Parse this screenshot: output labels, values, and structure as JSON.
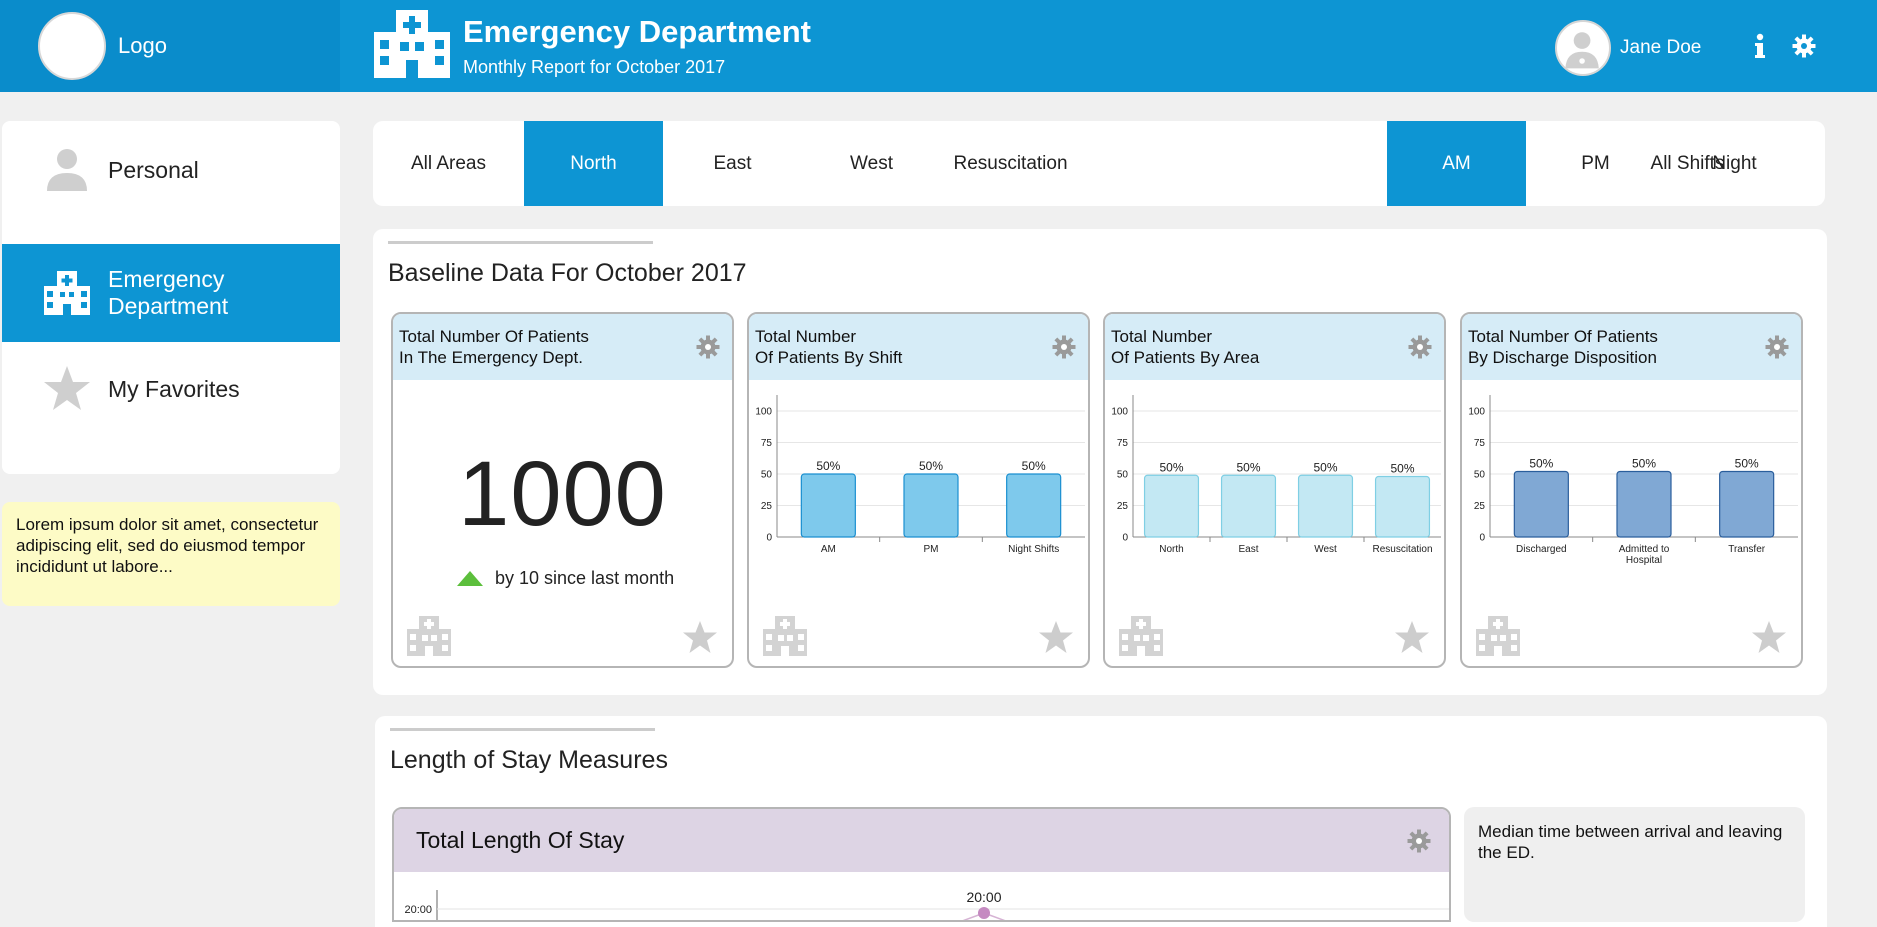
{
  "header": {
    "logo_label": "Logo",
    "title": "Emergency Department",
    "subtitle": "Monthly Report for October 2017",
    "user_name": "Jane Doe",
    "accent_color": "#0d95d3"
  },
  "sidebar": {
    "items": [
      {
        "label": "Personal",
        "icon": "person-icon"
      },
      {
        "label": "Emergency Department",
        "icon": "hospital-icon",
        "active": true
      },
      {
        "label": "My Favorites",
        "icon": "star-icon"
      }
    ],
    "note": "Lorem ipsum dolor sit amet, consectetur adipiscing elit, sed do eiusmod tempor incididunt ut labore..."
  },
  "filters": {
    "areas": [
      "All Areas",
      "North",
      "East",
      "West",
      "Resuscitation"
    ],
    "selected_area": "North",
    "shifts": [
      "All Shifts",
      "AM",
      "PM",
      "Night"
    ],
    "selected_shift": "AM"
  },
  "baseline": {
    "title": "Baseline Data For October 2017",
    "cards": [
      {
        "title_line1": "Total Number Of Patients",
        "title_line2": "In The Emergency Dept.",
        "value": "1000",
        "trend": "by 10 since last month"
      },
      {
        "title_line1": "Total Number",
        "title_line2": "Of Patients By Shift"
      },
      {
        "title_line1": "Total Number",
        "title_line2": "Of Patients By Area"
      },
      {
        "title_line1": "Total Number Of Patients",
        "title_line2": "By Discharge Disposition"
      }
    ]
  },
  "chart_data": [
    {
      "type": "bar",
      "categories": [
        "AM",
        "PM",
        "Night Shifts"
      ],
      "values": [
        50,
        50,
        50
      ],
      "data_labels": [
        "50%",
        "50%",
        "50%"
      ],
      "ylim": [
        0,
        100
      ],
      "yticks": [
        0,
        25,
        50,
        75,
        100
      ],
      "bar_color": "#7ec9ec",
      "bar_border": "#1a8fd0"
    },
    {
      "type": "bar",
      "categories": [
        "North",
        "East",
        "West",
        "Resuscitation"
      ],
      "values": [
        49,
        49,
        49,
        48
      ],
      "data_labels": [
        "50%",
        "50%",
        "50%",
        "50%"
      ],
      "ylim": [
        0,
        100
      ],
      "yticks": [
        0,
        25,
        50,
        75,
        100
      ],
      "bar_color": "#c3e8f3",
      "bar_border": "#7fcfe4"
    },
    {
      "type": "bar",
      "categories": [
        "Discharged",
        "Admitted to Hospital",
        "Transfer"
      ],
      "values": [
        52,
        52,
        52
      ],
      "data_labels": [
        "50%",
        "50%",
        "50%"
      ],
      "ylim": [
        0,
        100
      ],
      "yticks": [
        0,
        25,
        50,
        75,
        100
      ],
      "bar_color": "#80a8d4",
      "bar_border": "#2a5e9c"
    }
  ],
  "los": {
    "title": "Length of Stay Measures",
    "card_title": "Total Length Of Stay",
    "y_tick": "20:00",
    "point_label": "20:00",
    "description": "Median time between arrival and leaving the ED.",
    "head_color": "#ddd4e4",
    "point_color": "#c58ac1"
  }
}
